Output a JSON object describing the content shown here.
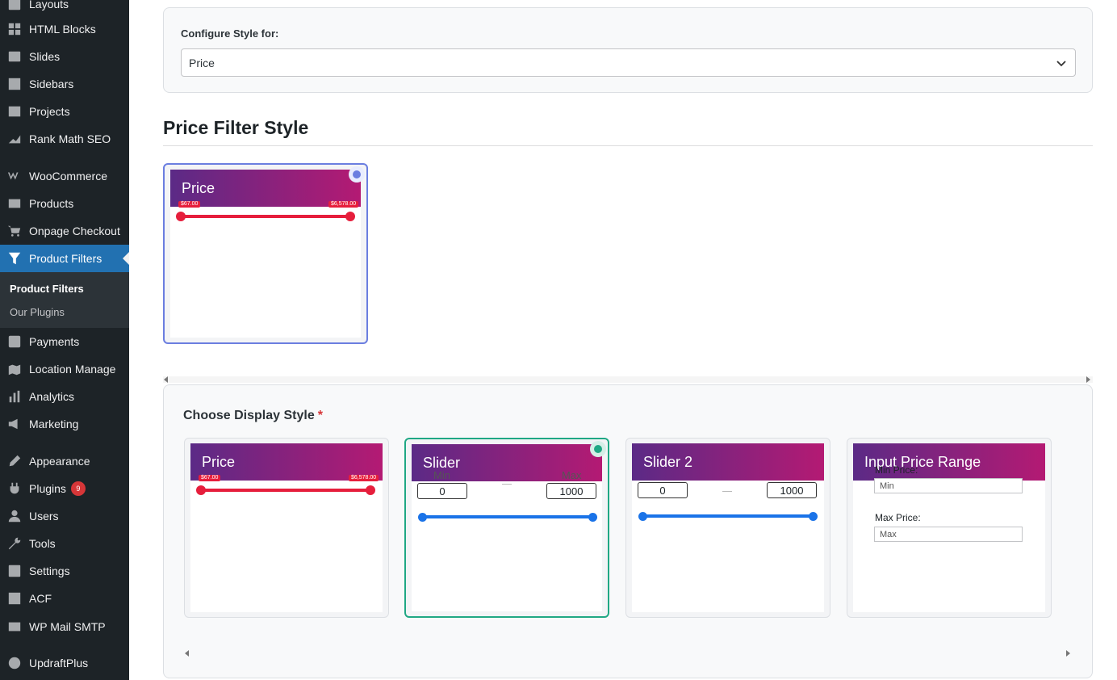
{
  "sidebar": {
    "items": [
      {
        "label": "Layouts",
        "icon": "layouts-icon"
      },
      {
        "label": "HTML Blocks",
        "icon": "html-blocks-icon"
      },
      {
        "label": "Slides",
        "icon": "slides-icon"
      },
      {
        "label": "Sidebars",
        "icon": "sidebars-icon"
      },
      {
        "label": "Projects",
        "icon": "projects-icon"
      },
      {
        "label": "Rank Math SEO",
        "icon": "rank-math-icon"
      },
      {
        "label": "WooCommerce",
        "icon": "woocommerce-icon"
      },
      {
        "label": "Products",
        "icon": "products-icon"
      },
      {
        "label": "Onpage Checkout",
        "icon": "cart-icon"
      },
      {
        "label": "Product Filters",
        "icon": "filter-icon"
      },
      {
        "label": "Payments",
        "icon": "payments-icon"
      },
      {
        "label": "Location Manage",
        "icon": "location-icon"
      },
      {
        "label": "Analytics",
        "icon": "analytics-icon"
      },
      {
        "label": "Marketing",
        "icon": "marketing-icon"
      },
      {
        "label": "Appearance",
        "icon": "appearance-icon"
      },
      {
        "label": "Plugins",
        "icon": "plugins-icon",
        "badge": "9"
      },
      {
        "label": "Users",
        "icon": "users-icon"
      },
      {
        "label": "Tools",
        "icon": "tools-icon"
      },
      {
        "label": "Settings",
        "icon": "settings-icon"
      },
      {
        "label": "ACF",
        "icon": "acf-icon"
      },
      {
        "label": "WP Mail SMTP",
        "icon": "mail-icon"
      },
      {
        "label": "UpdraftPlus",
        "icon": "updraft-icon"
      }
    ],
    "submenu": [
      {
        "label": "Product Filters"
      },
      {
        "label": "Our Plugins"
      }
    ]
  },
  "config": {
    "label": "Configure Style for:",
    "selected": "Price"
  },
  "section_title": "Price Filter Style",
  "price_filter_card": {
    "title": "Price",
    "min_tip": "$67.00",
    "max_tip": "$6,578.00"
  },
  "display": {
    "title": "Choose Display Style",
    "required_mark": "*",
    "cards": [
      {
        "title": "Price",
        "min_tip": "$67.00",
        "max_tip": "$6,578.00"
      },
      {
        "title": "Slider",
        "min_label": "Min",
        "max_label": "Max",
        "min_value": "0",
        "max_value": "1000"
      },
      {
        "title": "Slider 2",
        "min_value": "0",
        "max_value": "1000"
      },
      {
        "title": "Input Price Range",
        "min_label": "Min Price:",
        "min_placeholder": "Min",
        "max_label": "Max Price:",
        "max_placeholder": "Max"
      }
    ]
  },
  "colors": {
    "sidebar_bg": "#1d2327",
    "active": "#2271b1",
    "gradient_start": "#5b2a86",
    "gradient_end": "#b41a73",
    "range_red": "#e61e3c",
    "slider_blue": "#1a73e8",
    "selected_blue": "#6b7ee0",
    "selected_green": "#20a884"
  }
}
